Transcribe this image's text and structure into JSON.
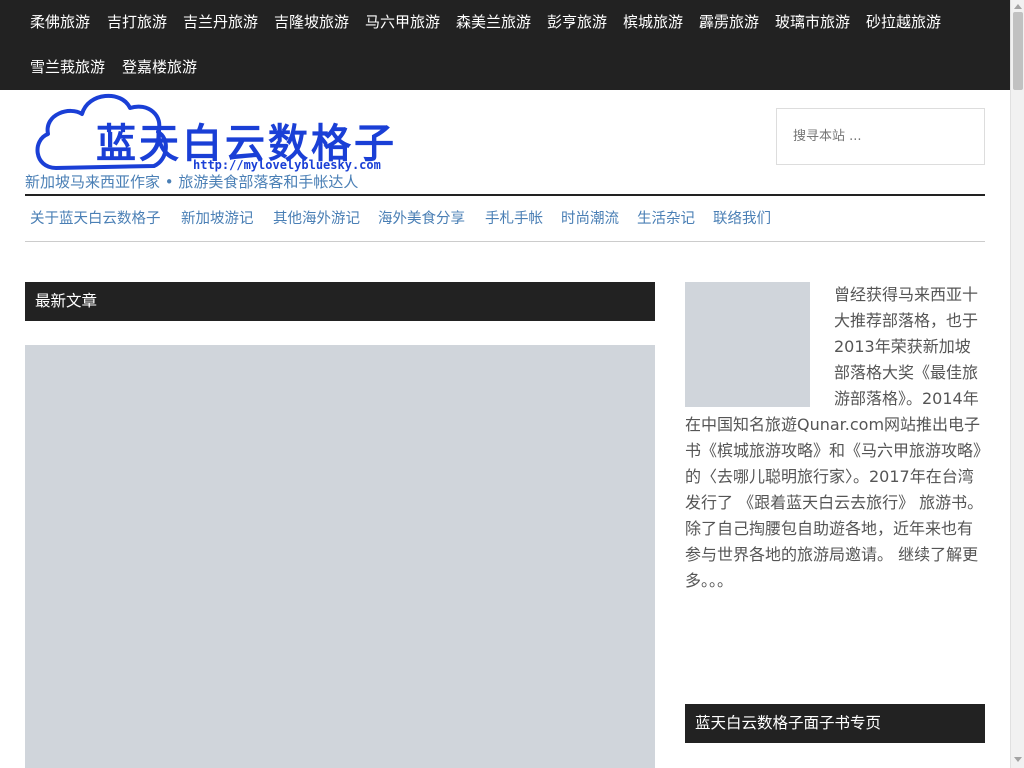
{
  "topnav": {
    "items": [
      "柔佛旅游",
      "吉打旅游",
      "吉兰丹旅游",
      "吉隆坡旅游",
      "马六甲旅游",
      "森美兰旅游",
      "彭亨旅游",
      "槟城旅游",
      "霹雳旅游",
      "玻璃市旅游",
      "砂拉越旅游",
      "雪兰莪旅游",
      "登嘉楼旅游"
    ]
  },
  "site": {
    "logo_text": "蓝天白云数格子",
    "logo_url": "http://mylovelybluesky.com",
    "tagline": "新加坡马来西亚作家 • 旅游美食部落客和手帐达人"
  },
  "search": {
    "placeholder": "搜寻本站 ..."
  },
  "mainnav": {
    "items": [
      "关于蓝天白云数格子",
      "新加坡游记",
      "其他海外游记",
      "海外美食分享",
      "手札手帐",
      "时尚潮流",
      "生活杂记",
      "联络我们"
    ]
  },
  "main": {
    "latest_header": "最新文章"
  },
  "sidebar": {
    "about": "曾经获得马来西亚十大推荐部落格，也于2013年荣获新加坡部落格大奖《最佳旅游部落格》。2014年在中国知名旅遊Qunar.com网站推出电子书《槟城旅游攻略》和《马六甲旅游攻略》的〈去哪儿聪明旅行家〉。2017年在台湾发行了 《跟着蓝天白云去旅行》 旅游书。除了自己掏腰包自助遊各地，近年来也有参与世界各地的旅游局邀请。 继续了解更多。。。",
    "fb_header": "蓝天白云数格子面子书专页"
  },
  "colors": {
    "nav_bg": "#222222",
    "link": "#4a7fb5",
    "logo_blue": "#1a3fd6",
    "placeholder": "#d0d5db"
  }
}
